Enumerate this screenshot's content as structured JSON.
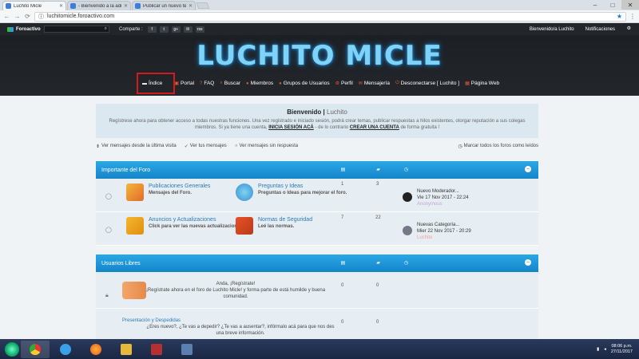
{
  "browser": {
    "tabs": [
      {
        "title": "Luchito Micle",
        "active": true
      },
      {
        "title": "- Bienvenido a la admi",
        "active": false
      },
      {
        "title": "Publicar un nuevo tema",
        "active": false
      }
    ],
    "url": "luchitomicle.foroactivo.com",
    "close": "✕"
  },
  "topbar": {
    "brand": "Foroactivo",
    "share_label": "Comparte :",
    "socials": [
      "f",
      "t",
      "g+",
      "✉",
      "rss"
    ],
    "welcome": "Bienvenido/a Luchito",
    "notifications": "Notificaciones"
  },
  "header": {
    "logo_text": "LUCHITO MICLE",
    "nav": [
      {
        "label": "Índice",
        "icon": "home-icon"
      },
      {
        "label": "Portal",
        "icon": "portal-icon"
      },
      {
        "label": "FAQ",
        "icon": "faq-icon"
      },
      {
        "label": "Buscar",
        "icon": "search-icon"
      },
      {
        "label": "Miembros",
        "icon": "members-icon"
      },
      {
        "label": "Grupos de Usuarios",
        "icon": "groups-icon"
      },
      {
        "label": "Perfil",
        "icon": "profile-icon"
      },
      {
        "label": "Mensajería",
        "icon": "mail-icon"
      },
      {
        "label": "Desconectarse [ Luchito ]",
        "icon": "logout-icon"
      },
      {
        "label": "Página Web",
        "icon": "web-icon"
      }
    ]
  },
  "welcome_box": {
    "title": "Bienvenido |",
    "user": "Luchito",
    "desc_1": "Regístrese ahora para obtener acceso a todas nuestras funciones. Una vez registrado e iniciado sesión, podrá crear temas, publicar respuestas a hilos existentes, otorgar reputación a sus colegas miembros. Si ya tiene una cuenta,",
    "login_link": "INICIA SESIÓN ACÁ",
    "desc_2": "- de lo contrario",
    "register_link": "CREAR UNA CUENTA",
    "desc_3": "de forma gratuita !"
  },
  "quicklinks": {
    "since_last": "Ver mensajes desde la última visita",
    "your_posts": "Ver tus mensajes",
    "unanswered": "Ver mensajes sin respuesta",
    "mark_read": "Marcar todos los foros como leídos"
  },
  "categories": [
    {
      "name": "Importante del Foro",
      "rows": [
        {
          "left": {
            "title": "Publicaciones Generales",
            "desc": "Mensajes del Foro."
          },
          "right": {
            "title": "Preguntas y Ideas",
            "desc": "Preguntas o Ideas para mejorar el foro."
          },
          "topics": "1",
          "posts": "3",
          "last_title": "Nuevo Moderador...",
          "last_date": "Vie 17 Nov 2017 - 22:24",
          "last_user": "Anonymous"
        },
        {
          "left": {
            "title": "Anuncios y Actualizaciones",
            "desc": "Click para ver las nuevas actualizaciones."
          },
          "right": {
            "title": "Normas de Seguridad",
            "desc": "Leé las normas."
          },
          "topics": "7",
          "posts": "22",
          "last_title": "Nuevas Categoría...",
          "last_date": "Mier 22 Nov 2017 - 20:29",
          "last_user": "Luchito"
        }
      ]
    },
    {
      "name": "Usuarios Libres",
      "rows": [
        {
          "line1": "Anda, ¡Regístrate!",
          "line2": "¡Regístrate ahora en el foro de Luchito Micle! y forma parte de está humilde y buena comunidad.",
          "topics": "0",
          "posts": "0"
        },
        {
          "line1": "Presentación y Despedidas",
          "line2": "¿Eres nuevo?, ¿Te vas a depedir? ¿Te vas a ausentar?, infórmalo acá para que nos des una breve información.",
          "topics": "0",
          "posts": "0"
        }
      ]
    }
  ],
  "taskbar": {
    "time": "08:06 p.m.",
    "date": "27/11/2017"
  }
}
